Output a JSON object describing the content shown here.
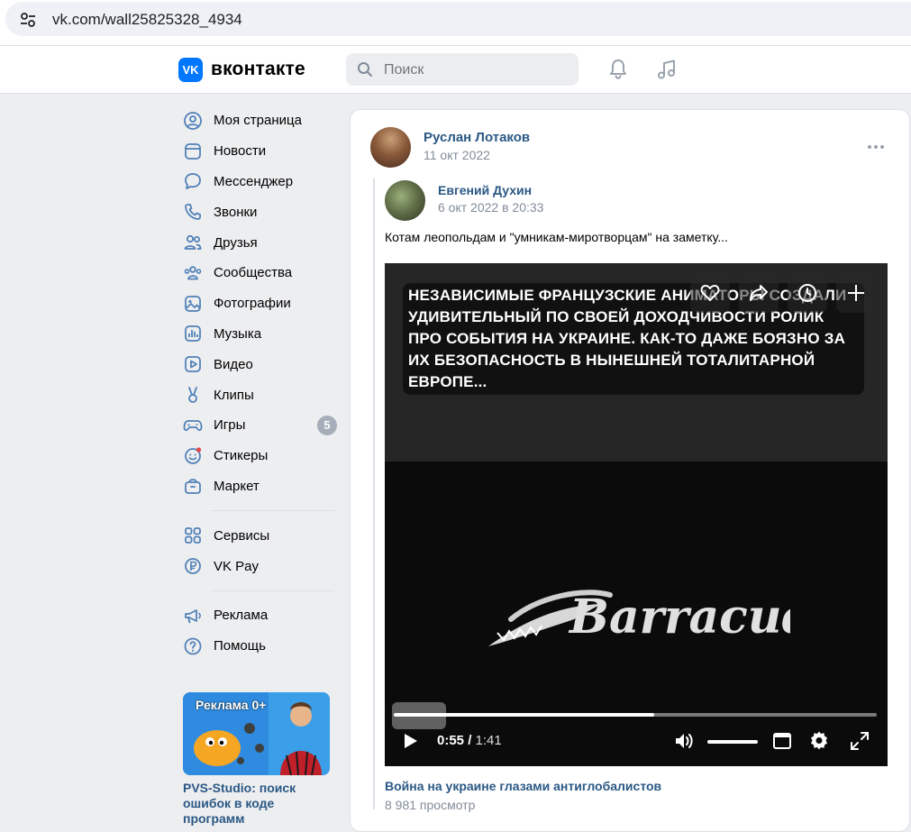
{
  "browser": {
    "url": "vk.com/wall25825328_4934",
    "icon": "tune-icon"
  },
  "header": {
    "logo_mark": "VK",
    "logo_text": "вконтакте",
    "search_placeholder": "Поиск",
    "icons": [
      "search-icon",
      "bell-icon",
      "music-icon"
    ]
  },
  "sidebar": {
    "items": [
      {
        "label": "Моя страница",
        "icon": "user-circle-icon"
      },
      {
        "label": "Новости",
        "icon": "newsfeed-icon"
      },
      {
        "label": "Мессенджер",
        "icon": "message-icon"
      },
      {
        "label": "Звонки",
        "icon": "phone-icon"
      },
      {
        "label": "Друзья",
        "icon": "friends-icon"
      },
      {
        "label": "Сообщества",
        "icon": "communities-icon"
      },
      {
        "label": "Фотографии",
        "icon": "photo-icon"
      },
      {
        "label": "Музыка",
        "icon": "music-icon"
      },
      {
        "label": "Видео",
        "icon": "video-icon"
      },
      {
        "label": "Клипы",
        "icon": "clips-icon"
      },
      {
        "label": "Игры",
        "icon": "gamepad-icon",
        "badge": "5"
      },
      {
        "label": "Стикеры",
        "icon": "sticker-icon"
      },
      {
        "label": "Маркет",
        "icon": "market-bag-icon"
      }
    ],
    "items2": [
      {
        "label": "Сервисы",
        "icon": "services-grid-icon"
      },
      {
        "label": "VK Pay",
        "icon": "vkpay-icon"
      }
    ],
    "items3": [
      {
        "label": "Реклама",
        "icon": "megaphone-icon"
      },
      {
        "label": "Помощь",
        "icon": "help-icon"
      }
    ],
    "ad": {
      "badge": "Реклама 0+",
      "title": "PVS-Studio: поиск ошибок в коде программ"
    }
  },
  "post": {
    "author": "Руслан Лотаков",
    "date": "11 окт 2022",
    "repost": {
      "author": "Евгений Духин",
      "date": "6 окт 2022 в 20:33",
      "text": "Котам леопольдам и \"умникам-миротворцам\" на заметку..."
    },
    "video": {
      "caption": "НЕЗАВИСИМЫЕ ФРАНЦУЗСКИЕ АНИМАТОРЫ СОЗДАЛИ УДИВИТЕЛЬНЫЙ ПО СВОЕЙ ДОХОДЧИВОСТИ РОЛИК ПРО СОБЫТИЯ НА УКРАИНЕ. КАК-ТО ДАЖЕ БОЯЗНО ЗА ИХ БЕЗОПАСНОСТЬ В НЫНЕШНЕЙ ТОТАЛИТАРНОЙ ЕВРОПЕ...",
      "logo_text": "Barracudas",
      "current_time": "0:55",
      "duration": "1:41",
      "progress": 0.54,
      "title": "Война на украине глазами антиглобалистов",
      "views": "8 981 просмотр"
    }
  },
  "colors": {
    "accent": "#0077ff",
    "link": "#2a5885",
    "muted": "#818c99",
    "background": "#edeef0"
  }
}
